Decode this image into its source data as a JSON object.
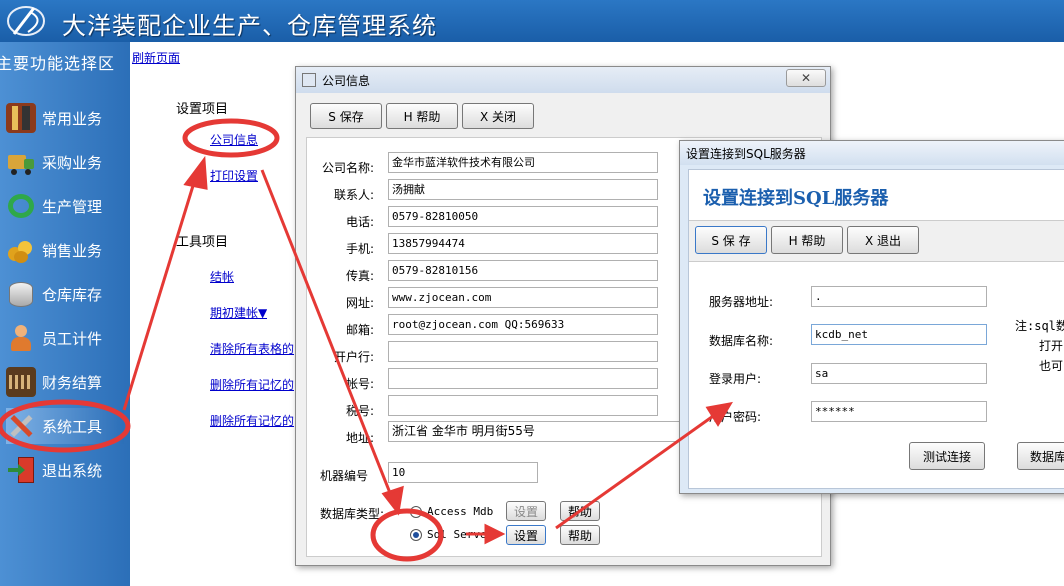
{
  "app": {
    "title": "大洋装配企业生产、仓库管理系统"
  },
  "sidebar": {
    "title": "主要功能选择区",
    "items": [
      {
        "label": "常用业务",
        "icon": "book-icon"
      },
      {
        "label": "采购业务",
        "icon": "truck-icon"
      },
      {
        "label": "生产管理",
        "icon": "recycle-icon"
      },
      {
        "label": "销售业务",
        "icon": "coins-icon"
      },
      {
        "label": "仓库库存",
        "icon": "database-icon"
      },
      {
        "label": "员工计件",
        "icon": "person-icon"
      },
      {
        "label": "财务结算",
        "icon": "calculator-icon"
      },
      {
        "label": "系统工具",
        "icon": "tools-icon"
      },
      {
        "label": "退出系统",
        "icon": "exit-icon"
      }
    ]
  },
  "content": {
    "refresh": "刷新页面",
    "settings_head": "设置项目",
    "settings_links": [
      "公司信息",
      "打印设置"
    ],
    "tools_head": "工具项目",
    "tools_links": [
      "结帐",
      "期初建帐▼",
      "清除所有表格的",
      "删除所有记忆的",
      "删除所有记忆的"
    ]
  },
  "company_dialog": {
    "title": "公司信息",
    "buttons": {
      "save": "S 保存",
      "help": "H 帮助",
      "close": "X 关闭"
    },
    "fields": [
      {
        "label": "公司名称:",
        "value": "金华市蓝洋软件技术有限公司"
      },
      {
        "label": "联系人:",
        "value": "汤拥献"
      },
      {
        "label": "电话:",
        "value": "0579-82810050"
      },
      {
        "label": "手机:",
        "value": "13857994474"
      },
      {
        "label": "传真:",
        "value": "0579-82810156"
      },
      {
        "label": "网址:",
        "value": "www.zjocean.com"
      },
      {
        "label": "邮箱:",
        "value": "root@zjocean.com  QQ:569633"
      },
      {
        "label": "开户行:",
        "value": ""
      },
      {
        "label": "帐号:",
        "value": ""
      },
      {
        "label": "税号:",
        "value": ""
      },
      {
        "label": "地址:",
        "value": "浙江省 金华市 明月街55号"
      }
    ],
    "machine_label": "机器编号",
    "machine_value": "10",
    "db_type_label": "数据库类型:",
    "db_options": [
      {
        "label": "Access Mdb",
        "checked": false
      },
      {
        "label": "Sql Server",
        "checked": true
      }
    ],
    "set_label": "设置",
    "help_label": "帮助"
  },
  "sql_dialog": {
    "title": "设置连接到SQL服务器",
    "heading": "设置连接到SQL服务器",
    "buttons": {
      "save": "S 保 存",
      "help": "H 帮助",
      "exit": "X 退出"
    },
    "fields": [
      {
        "label": "服务器地址:",
        "value": "."
      },
      {
        "label": "数据库名称:",
        "value": "kcdb_net"
      },
      {
        "label": "登录用户:",
        "value": "sa"
      },
      {
        "label": "用户密码:",
        "value": "******"
      }
    ],
    "note_lines": [
      "注:sql数",
      "打开",
      "也可"
    ],
    "test_button": "测试连接",
    "db_button": "数据库"
  },
  "colors": {
    "header": "#1a5ea8",
    "sidebar": "#2c6fb8",
    "annotation": "#e53935",
    "heading": "#1b5fae"
  }
}
